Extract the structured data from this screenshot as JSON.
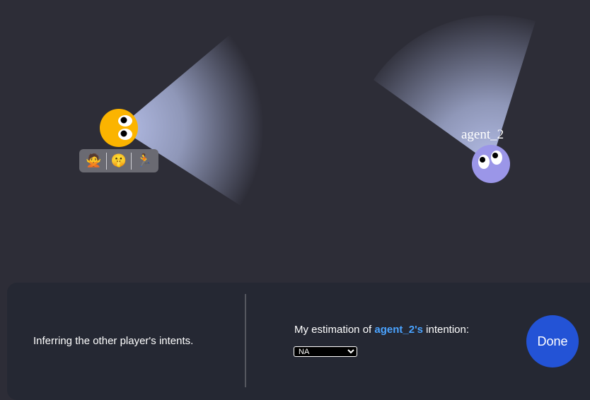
{
  "scene": {
    "agents": [
      {
        "id": "self",
        "label": "",
        "color": "#fbb400",
        "facing": "right"
      },
      {
        "id": "agent_2",
        "label": "agent_2",
        "color": "#9b96e8",
        "facing": "upper-right"
      }
    ],
    "emoji_bar": {
      "items": [
        {
          "emoji": "🙅",
          "name": "no-gesture-emoji"
        },
        {
          "emoji": "🤫",
          "name": "shush-emoji"
        },
        {
          "emoji": "🏃",
          "name": "running-emoji"
        }
      ]
    }
  },
  "panel": {
    "status": "Inferring the other player's intents.",
    "estimation_prefix": "My estimation of ",
    "estimation_agent": "agent_2's",
    "estimation_suffix": " intention:",
    "select_value": "NA",
    "done_label": "Done"
  },
  "colors": {
    "background": "#2d2d37",
    "panel": "#252833",
    "accent": "#4aa3ff",
    "done_button": "#2353d6"
  }
}
